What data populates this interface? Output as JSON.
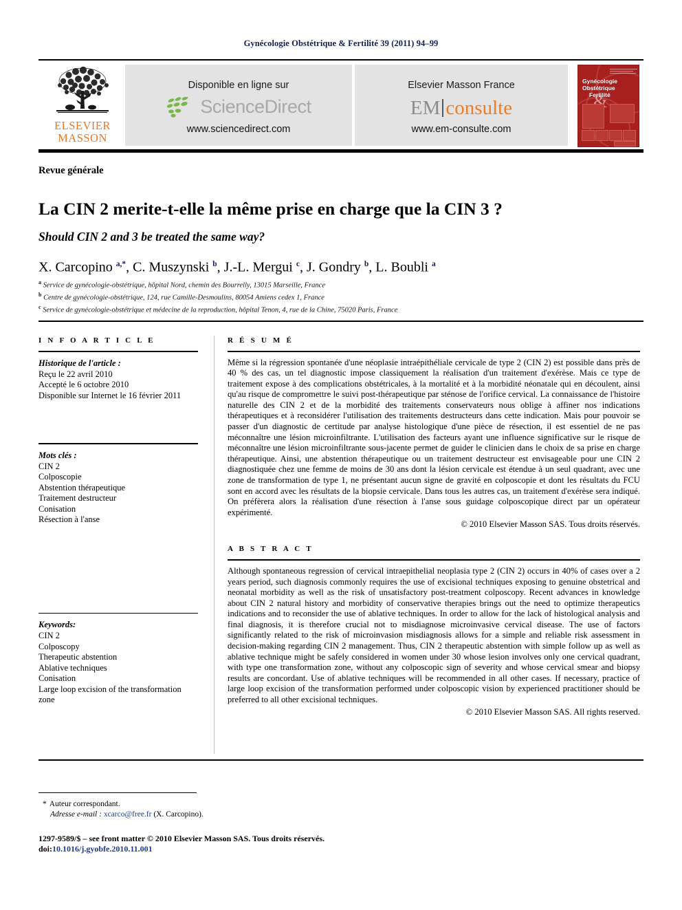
{
  "running_head": "Gynécologie Obstétrique & Fertilité 39 (2011) 94–99",
  "masthead": {
    "elsevier_logo_line1": "ELSEVIER",
    "elsevier_logo_line2": "MASSON",
    "sciencedirect": {
      "title": "Disponible en ligne sur",
      "wordmark": "ScienceDirect",
      "url": "www.sciencedirect.com"
    },
    "emconsulte": {
      "title": "Elsevier Masson France",
      "wordmark_gray": "EM",
      "wordmark_orange": "consulte",
      "url": "www.em-consulte.com"
    },
    "cover": {
      "title_line1": "Gynécologie",
      "title_line2": "Obstétrique",
      "title_line3": "Fertilité",
      "ampersand": "&"
    }
  },
  "article": {
    "section_type": "Revue générale",
    "title_fr": "La CIN 2 merite-t-elle la même prise en charge que la CIN 3 ?",
    "title_en": "Should CIN 2 and 3 be treated the same way?",
    "authors_html": "X. Carcopino <sup>a,*</sup>, C. Muszynski <sup>b</sup>, J.-L. Mergui <sup>c</sup>, J. Gondry <sup>b</sup>, L. Boubli <sup>a</sup>",
    "affiliations": [
      {
        "marker": "a",
        "text": "Service de gynécologie-obstétrique, hôpital Nord, chemin des Bourrelly, 13015 Marseille, France"
      },
      {
        "marker": "b",
        "text": "Centre de gynécologie-obstétrique, 124, rue Camille-Desmoulins, 80054 Amiens cedex 1, France"
      },
      {
        "marker": "c",
        "text": "Service de gynécologie-obstétrique et médecine de la reproduction, hôpital Tenon, 4, rue de la Chine, 75020 Paris, France"
      }
    ]
  },
  "info_column": {
    "heading": "I N F O   A R T I C L E",
    "history_label": "Historique de l'article :",
    "history": [
      "Reçu le 22 avril 2010",
      "Accepté le 6 octobre 2010",
      "Disponible sur Internet le 16 février 2011"
    ],
    "keywords_fr_label": "Mots clés :",
    "keywords_fr": [
      "CIN 2",
      "Colposcopie",
      "Abstention thérapeutique",
      "Traitement destructeur",
      "Conisation",
      "Résection à l'anse"
    ],
    "keywords_en_label": "Keywords:",
    "keywords_en": [
      "CIN 2",
      "Colposcopy",
      "Therapeutic abstention",
      "Ablative techniques",
      "Conisation",
      "Large loop excision of the transformation zone"
    ]
  },
  "resume": {
    "heading": "R É S U M É",
    "text": "Même si la régression spontanée d'une néoplasie intraépithéliale cervicale de type 2 (CIN 2) est possible dans près de 40 % des cas, un tel diagnostic impose classiquement la réalisation d'un traitement d'exérèse. Mais ce type de traitement expose à des complications obstétricales, à la mortalité et à la morbidité néonatale qui en découlent, ainsi qu'au risque de compromettre le suivi post-thérapeutique par sténose de l'orifice cervical. La connaissance de l'histoire naturelle des CIN 2 et de la morbidité des traitements conservateurs nous oblige à affiner nos indications thérapeutiques et à reconsidérer l'utilisation des traitements destructeurs dans cette indication. Mais pour pouvoir se passer d'un diagnostic de certitude par analyse histologique d'une pièce de résection, il est essentiel de ne pas méconnaître une lésion microinfiltrante. L'utilisation des facteurs ayant une influence significative sur le risque de méconnaître une lésion microinfiltrante sous-jacente permet de guider le clinicien dans le choix de sa prise en charge thérapeutique. Ainsi, une abstention thérapeutique ou un traitement destructeur est envisageable pour une CIN 2 diagnostiquée chez une femme de moins de 30 ans dont la lésion cervicale est étendue à un seul quadrant, avec une zone de transformation de type 1, ne présentant aucun signe de gravité en colposcopie et dont les résultats du FCU sont en accord avec les résultats de la biopsie cervicale. Dans tous les autres cas, un traitement d'exérèse sera indiqué. On préfèrera alors la réalisation d'une résection à l'anse sous guidage colposcopique direct par un opérateur expérimenté.",
    "copyright": "© 2010 Elsevier Masson SAS. Tous droits réservés."
  },
  "abstract": {
    "heading": "A B S T R A C T",
    "text": "Although spontaneous regression of cervical intraepithelial neoplasia type 2 (CIN 2) occurs in 40% of cases over a 2 years period, such diagnosis commonly requires the use of excisional techniques exposing to genuine obstetrical and neonatal morbidity as well as the risk of unsatisfactory post-treatment colposcopy. Recent advances in knowledge about CIN 2 natural history and morbidity of conservative therapies brings out the need to optimize therapeutics indications and to reconsider the use of ablative techniques. In order to allow for the lack of histological analysis and final diagnosis, it is therefore crucial not to misdiagnose microinvasive cervical disease. The use of factors significantly related to the risk of microinvasion misdiagnosis allows for a simple and reliable risk assessment in decision-making regarding CIN 2 management. Thus, CIN 2 therapeutic abstention with simple follow up as well as ablative technique might be safely considered in women under 30 whose lesion involves only one cervical quadrant, with type one transformation zone, without any colposcopic sign of severity and whose cervical smear and biopsy results are concordant. Use of ablative techniques will be recommended in all other cases. If necessary, practice of large loop excision of the transformation performed under colposcopic vision by experienced practitioner should be preferred to all other excisional techniques.",
    "copyright": "© 2010 Elsevier Masson SAS. All rights reserved."
  },
  "footnotes": {
    "star": "*",
    "corresponding": "Auteur correspondant.",
    "email_label": "Adresse e-mail :",
    "email": "xcarco@free.fr",
    "email_owner": "(X. Carcopino).",
    "front_matter": "1297-9589/$ – see front matter © 2010 Elsevier Masson SAS. Tous droits réservés.",
    "doi_label": "doi:",
    "doi": "10.1016/j.gyobfe.2010.11.001"
  },
  "colors": {
    "journal_blue": "#141e50",
    "elsevier_orange": "#e87722",
    "em_orange": "#ef7c22",
    "sd_green": "#7ab648",
    "sd_gray": "#a8a8a8",
    "cover_red": "#a8201e",
    "link_blue": "#1c3b8b"
  }
}
